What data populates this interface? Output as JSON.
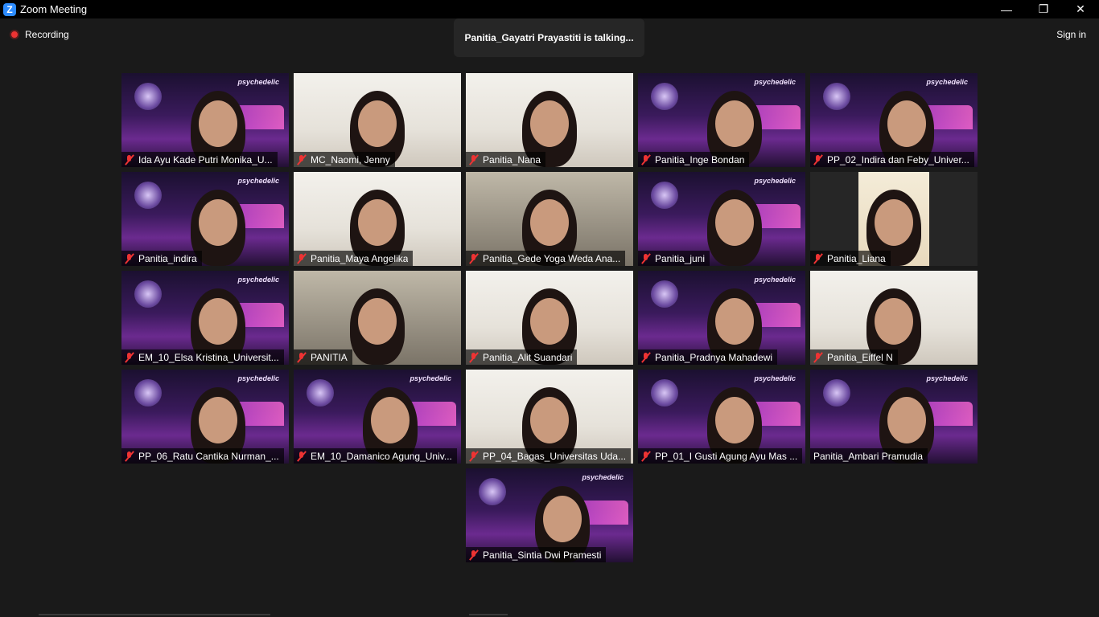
{
  "window": {
    "title": "Zoom Meeting",
    "logo_letter": "Z",
    "minimize": "—",
    "restore": "❐",
    "close": "✕"
  },
  "topbar": {
    "recording_label": "Recording",
    "talking_text": "Panitia_Gayatri Prayastiti is talking...",
    "signin_label": "Sign in"
  },
  "participants": [
    {
      "name": "Ida Ayu Kade Putri Monika_U...",
      "bg": "psy"
    },
    {
      "name": "MC_Naomi, Jenny",
      "bg": "room"
    },
    {
      "name": "Panitia_Nana",
      "bg": "room"
    },
    {
      "name": "Panitia_Inge Bondan",
      "bg": "psy"
    },
    {
      "name": "PP_02_Indira dan Feby_Univer...",
      "bg": "psy"
    },
    {
      "name": "Panitia_indira",
      "bg": "psy"
    },
    {
      "name": "Panitia_Maya Angelika",
      "bg": "room"
    },
    {
      "name": "Panitia_Gede Yoga Weda Ana...",
      "bg": "dim"
    },
    {
      "name": "Panitia_juni",
      "bg": "psy"
    },
    {
      "name": "Panitia_Liana",
      "bg": "dark"
    },
    {
      "name": "EM_10_Elsa Kristina_Universit...",
      "bg": "psy"
    },
    {
      "name": "PANITIA",
      "bg": "dim"
    },
    {
      "name": "Panitia_Alit Suandari",
      "bg": "room"
    },
    {
      "name": "Panitia_Pradnya Mahadewi",
      "bg": "psy"
    },
    {
      "name": "Panitia_Eiffel N",
      "bg": "room"
    },
    {
      "name": "PP_06_Ratu Cantika Nurman_...",
      "bg": "psy"
    },
    {
      "name": "EM_10_Damanico Agung_Univ...",
      "bg": "psy"
    },
    {
      "name": "PP_04_Bagas_Universitas Uda...",
      "bg": "room"
    },
    {
      "name": "PP_01_I Gusti Agung Ayu Mas ...",
      "bg": "psy"
    },
    {
      "name": "Panitia_Ambari Pramudia",
      "bg": "psy",
      "no_mic": true
    },
    {
      "name": "Panitia_Sintia Dwi Pramesti",
      "bg": "psy"
    }
  ],
  "psy_word": "psychedelic"
}
